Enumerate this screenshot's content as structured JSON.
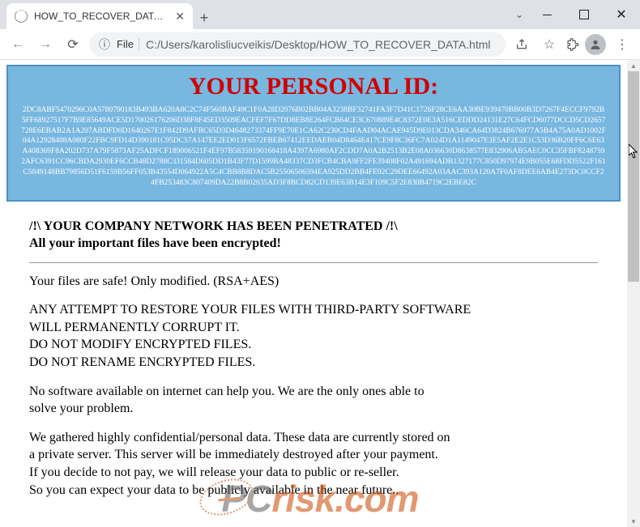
{
  "window": {
    "tab_title": "HOW_TO_RECOVER_DATA.html"
  },
  "addressbar": {
    "scheme_label": "File",
    "url": "C:/Users/karolisliucveikis/Desktop/HOW_TO_RECOVER_DATA.html"
  },
  "ransom": {
    "id_title": "YOUR PERSONAL ID:",
    "id_hex": "2DC8ABF5470296C0A5780790183B493BA620A8C2C74F560BAF49C1F0A28D2076B02BB04A3238BF32741FA3F7D41C1726F28CE6AA30BE939470BB00B3D7267F4ECCF9792B5FF68927517F7B9E85649ACE5D170026176206D38F8F45ED3509EACFEF7F67DD8EB8E264FCB64CE3C670889E4C8372E0E3A516CEDDD24131E27C64FCD6077DCCD5CD2657728E6EBAB2A1A207ABDFD0D1640267E1F842D9AFBC65D3D4648273374FF9E70E1CA62C230CD4FAAD04ACAE945D9E013CDA346CA64D3824B676977A5B4A75A0AD1002F04A12928488A080F22FBC9FD14D390181C95DC57A147EE2ED013F6572FBEB67412EEDAEB04D8464E417CE9F8C36FC7A024D1A1149047E3E5AF2E2E1C53D36B20FF6C6E63A408369F8A202D737A79F5873AF25ADFCF189006521F4EF97B58359190168418A4397A6980AF2CDD7A0A2B2513B2E08A036630D8638577E832906AB5AEC0CC35FBF82487592AFC6391CC96CBDA2930EF6CCB48D2788C331584D605DD1B43F77D1599BA48337CD3FCB4CBA9FF2FE39408F02A491694ADB1327177C850D97974E9B055E68FDD5522F161C5049148BB79856D51F6159B56FF053B43554D064922A5C4CBB8B8DAC5B25506506594EA925DD2BB4FE92C29DEE66492A03AAC393A120A7F0AF8DEE6AB4E273DC0CCF24FB253483C807409DA22B8B02635AD3F8BCD82CD139E63B14E3F109C5F2E830B4719C2EBE82C",
    "warn1": "/!\\ YOUR COMPANY NETWORK HAS BEEN PENETRATED /!\\",
    "warn2": "All your important files have been encrypted!",
    "p_safe": "Your files are safe! Only modified. (RSA+AES)",
    "p_attempt1": "ANY ATTEMPT TO RESTORE YOUR FILES WITH THIRD-PARTY SOFTWARE",
    "p_attempt2": "WILL PERMANENTLY CORRUPT IT.",
    "p_modify": "DO NOT MODIFY ENCRYPTED FILES.",
    "p_rename": "DO NOT RENAME ENCRYPTED FILES.",
    "p_nosw1": "No software available on internet can help you. We are the only ones able to",
    "p_nosw2": "solve your problem.",
    "p_gather1": "We gathered highly confidential/personal data. These data are currently stored on",
    "p_gather2": "a private server. This server will be immediately destroyed after your payment.",
    "p_gather3": "If you decide to not pay, we will release your data to public or re-seller.",
    "p_gather4": "So you can expect your data to be publicly available in the near future.."
  },
  "watermark": {
    "part1": "PC",
    "part2": "risk",
    "part3": ".com"
  }
}
